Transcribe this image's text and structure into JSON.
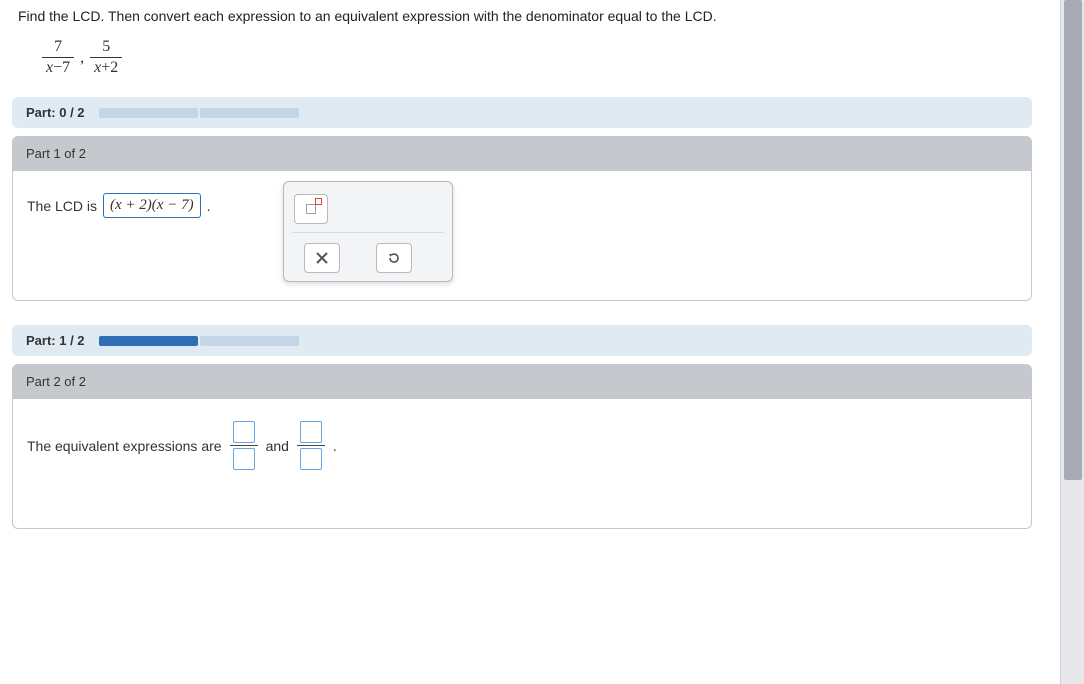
{
  "question": "Find the LCD. Then convert each expression to an equivalent expression with the denominator equal to the LCD.",
  "fractions": {
    "f1_num": "7",
    "f1_den_pre": "x",
    "f1_den_op": "−",
    "f1_den_post": "7",
    "sep": ",",
    "f2_num": "5",
    "f2_den_pre": "x",
    "f2_den_op": "+",
    "f2_den_post": "2"
  },
  "progress0": {
    "label": "Part: 0 / 2"
  },
  "part1": {
    "header": "Part 1 of 2",
    "lcd_prefix": "The LCD is",
    "lcd_answer": "(x + 2)(x − 7)",
    "period": "."
  },
  "progress1": {
    "label": "Part: 1 / 2"
  },
  "part2": {
    "header": "Part 2 of 2",
    "prefix": "The equivalent expressions are",
    "and": "and",
    "period": "."
  },
  "tools": {
    "exponent": "exponent-template",
    "clear": "clear",
    "reset": "reset"
  }
}
